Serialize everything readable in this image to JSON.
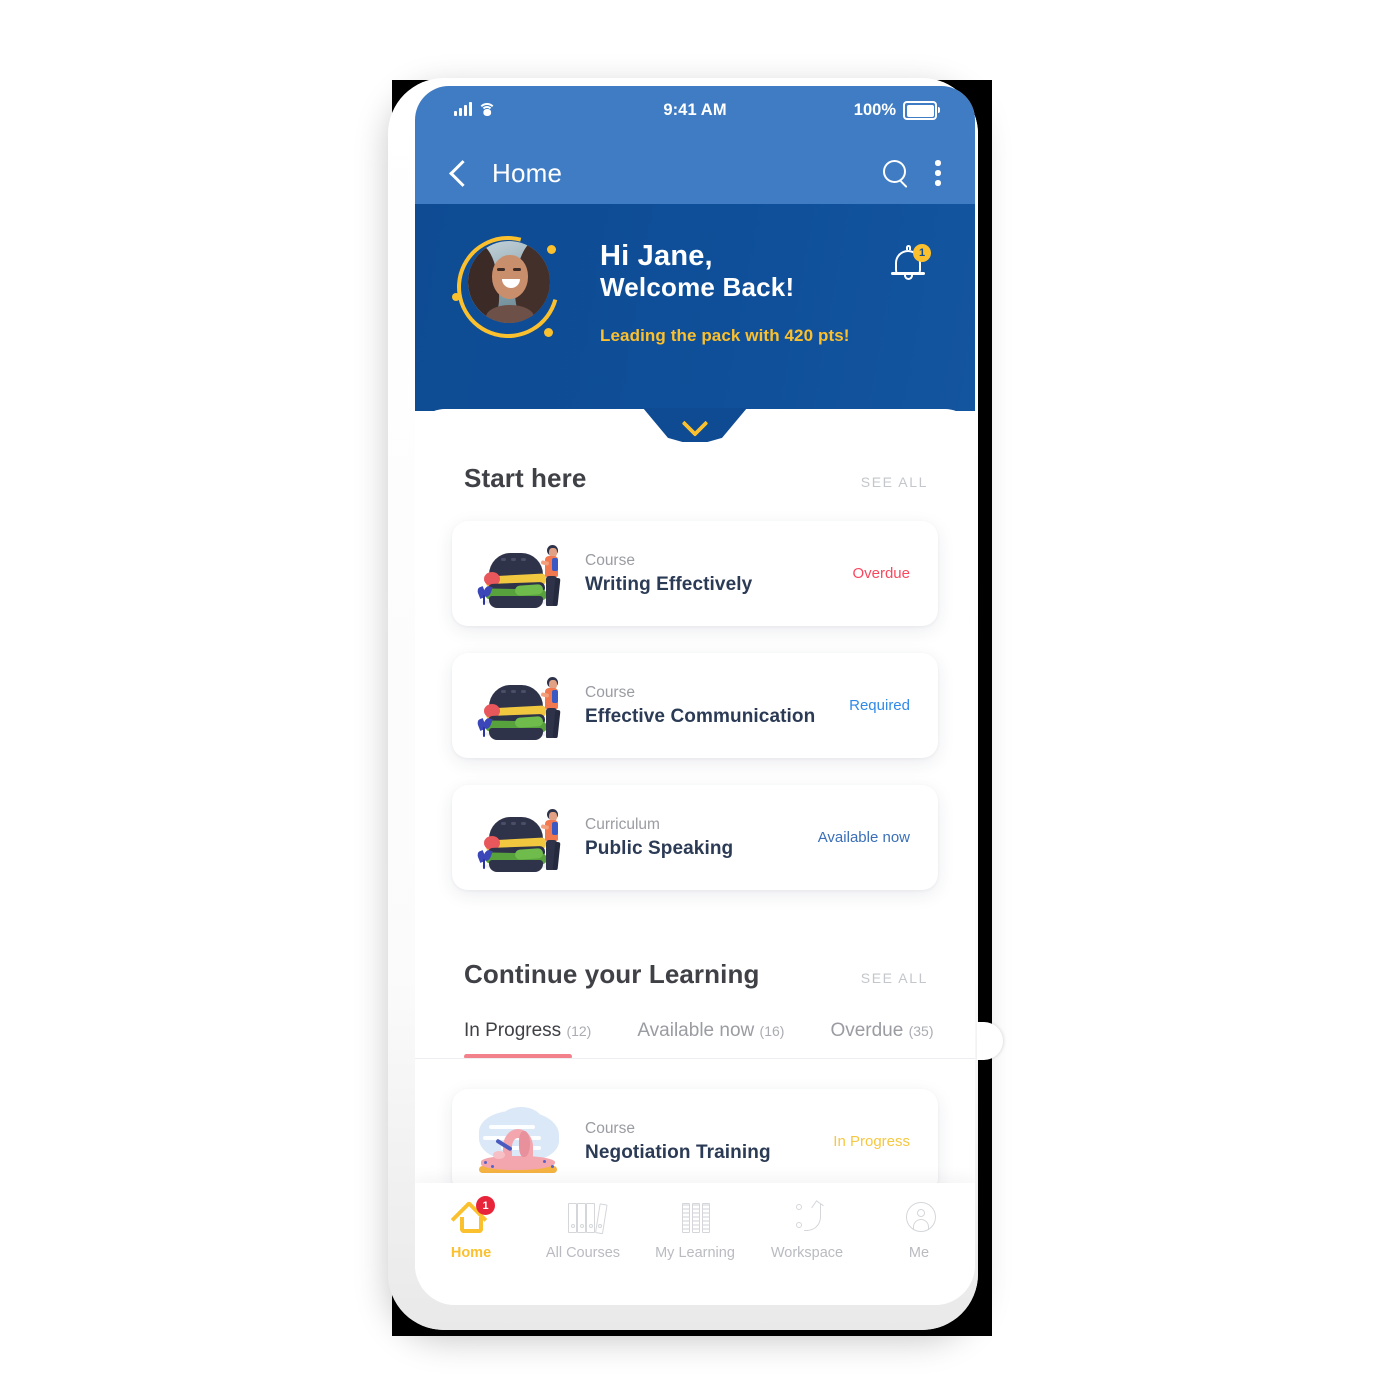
{
  "status_bar": {
    "time": "9:41 AM",
    "battery_percent": "100%",
    "signal_icon": "signal-bars-icon",
    "wifi_icon": "wifi-icon",
    "battery_icon": "battery-icon"
  },
  "app_bar": {
    "back_icon": "back-chevron-icon",
    "title": "Home",
    "search_icon": "search-icon",
    "overflow_icon": "kebab-menu-icon"
  },
  "hero": {
    "greeting_line1": "Hi Jane,",
    "greeting_line2": "Welcome Back!",
    "points_text": "Leading the pack with 420 pts!",
    "avatar_icon": "user-avatar",
    "bell_icon": "notification-bell-icon",
    "bell_badge": "1",
    "collapse_icon": "chevron-down-icon",
    "bg_color": "#0e4b93",
    "accent_color": "#fbc02d"
  },
  "start_here": {
    "title": "Start here",
    "see_all": "SEE ALL",
    "cards": [
      {
        "kind": "Course",
        "name": "Writing Effectively",
        "status": "Overdue",
        "status_color": "#f8485e",
        "illustration": "burger-illustration"
      },
      {
        "kind": "Course",
        "name": "Effective Communication",
        "status": "Required",
        "status_color": "#2f8ae8",
        "illustration": "burger-illustration"
      },
      {
        "kind": "Curriculum",
        "name": "Public Speaking",
        "status": "Available now",
        "status_color": "#3a6fb8",
        "illustration": "burger-illustration"
      }
    ]
  },
  "continue_learning": {
    "title": "Continue your Learning",
    "see_all": "SEE ALL",
    "tabs": [
      {
        "label": "In Progress",
        "count": "(12)",
        "active": true
      },
      {
        "label": "Available now",
        "count": "(16)",
        "active": false
      },
      {
        "label": "Overdue",
        "count": "(35)",
        "active": false
      }
    ],
    "active_underline_color": "#f2818b",
    "cards": [
      {
        "kind": "Course",
        "name": "Negotiation Training",
        "status": "In Progress",
        "status_color": "#f5c842",
        "illustration": "beach-swimmer-illustration"
      }
    ]
  },
  "bottom_nav": {
    "items": [
      {
        "label": "Home",
        "icon": "home-icon",
        "badge": "1",
        "active": true
      },
      {
        "label": "All Courses",
        "icon": "binders-icon",
        "badge": "",
        "active": false
      },
      {
        "label": "My Learning",
        "icon": "books-icon",
        "badge": "",
        "active": false
      },
      {
        "label": "Workspace",
        "icon": "workspace-icon",
        "badge": "",
        "active": false
      },
      {
        "label": "Me",
        "icon": "profile-icon",
        "badge": "",
        "active": false
      }
    ],
    "active_color": "#fbc02d",
    "badge_color": "#e8243a"
  }
}
